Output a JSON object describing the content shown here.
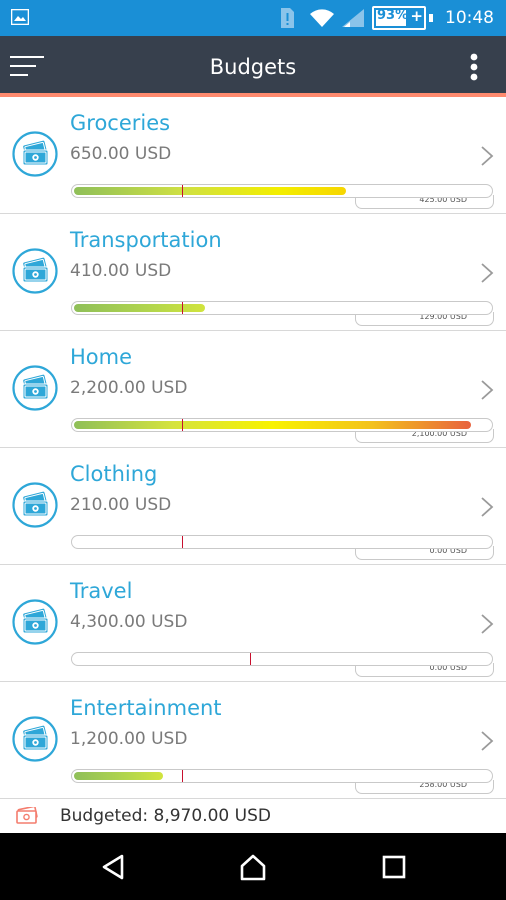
{
  "status_bar": {
    "battery": "93%",
    "time": "10:48",
    "icons": [
      "image-icon",
      "sim-alert-icon",
      "wifi-icon",
      "signal-icon",
      "battery-icon"
    ]
  },
  "app_bar": {
    "title": "Budgets",
    "icons": [
      "menu-icon",
      "more-vert-icon"
    ],
    "accent_color": "#ff8a6e",
    "background_color": "#37404d"
  },
  "budgets": [
    {
      "name": "Groceries",
      "amount": "650.00 USD",
      "spent": "425.00 USD",
      "spent_fraction": 0.654,
      "marker_fraction": 0.263
    },
    {
      "name": "Transportation",
      "amount": "410.00 USD",
      "spent": "129.00 USD",
      "spent_fraction": 0.315,
      "marker_fraction": 0.263
    },
    {
      "name": "Home",
      "amount": "2,200.00 USD",
      "spent": "2,100.00 USD",
      "spent_fraction": 0.955,
      "marker_fraction": 0.263
    },
    {
      "name": "Clothing",
      "amount": "210.00 USD",
      "spent": "0.00 USD",
      "spent_fraction": 0,
      "marker_fraction": 0.263
    },
    {
      "name": "Travel",
      "amount": "4,300.00 USD",
      "spent": "0.00 USD",
      "spent_fraction": 0,
      "marker_fraction": 0.425
    },
    {
      "name": "Entertainment",
      "amount": "1,200.00 USD",
      "spent": "258.00 USD",
      "spent_fraction": 0.215,
      "marker_fraction": 0.263
    }
  ],
  "footer": {
    "budgeted": "Budgeted: 8,970.00 USD"
  },
  "colors": {
    "name": "#2ea7d8",
    "icon": "#2ea7d8",
    "marker": "#c8102e",
    "status_bar": "#1a8fd6"
  }
}
